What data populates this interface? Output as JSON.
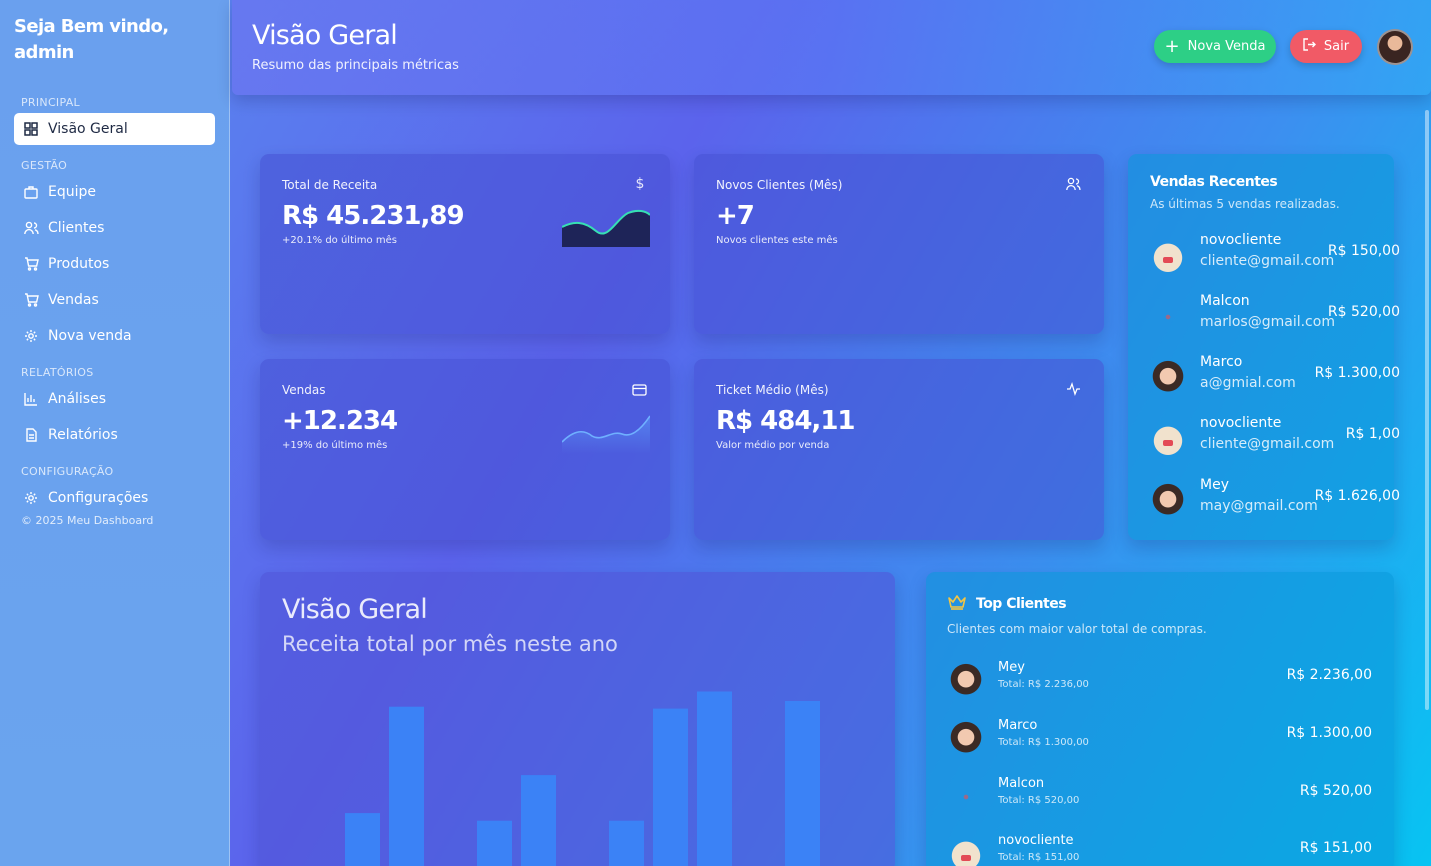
{
  "sidebar": {
    "welcome": "Seja Bem vindo, admin",
    "sections": [
      {
        "label": "PRINCIPAL",
        "items": [
          {
            "label": "Visão Geral",
            "icon": "grid-icon",
            "active": true
          }
        ]
      },
      {
        "label": "GESTÃO",
        "items": [
          {
            "label": "Equipe",
            "icon": "briefcase-icon"
          },
          {
            "label": "Clientes",
            "icon": "users-icon"
          },
          {
            "label": "Produtos",
            "icon": "cart-icon"
          },
          {
            "label": "Vendas",
            "icon": "cart-icon"
          },
          {
            "label": "Nova venda",
            "icon": "gear-icon"
          }
        ]
      },
      {
        "label": "RELATÓRIOS",
        "items": [
          {
            "label": "Análises",
            "icon": "bar-chart-icon"
          },
          {
            "label": "Relatórios",
            "icon": "document-icon"
          }
        ]
      },
      {
        "label": "CONFIGURAÇÃO",
        "items": [
          {
            "label": "Configurações",
            "icon": "gear-icon"
          }
        ]
      }
    ],
    "copyright": "© 2025 Meu Dashboard"
  },
  "header": {
    "title": "Visão Geral",
    "subtitle": "Resumo das principais métricas",
    "new_sale_label": "Nova Venda",
    "logout_label": "Sair"
  },
  "stats": [
    {
      "label": "Total de Receita",
      "value": "R$ 45.231,89",
      "sub": "+20.1% do último mês",
      "icon": "dollar-icon"
    },
    {
      "label": "Novos Clientes (Mês)",
      "value": "+7",
      "sub": "Novos clientes este mês",
      "icon": "users-icon"
    },
    {
      "label": "Vendas",
      "value": "+12.234",
      "sub": "+19% do último mês",
      "icon": "credit-card-icon"
    },
    {
      "label": "Ticket Médio (Mês)",
      "value": "R$ 484,11",
      "sub": "Valor médio por venda",
      "icon": "activity-icon"
    }
  ],
  "recent_sales": {
    "title": "Vendas Recentes",
    "subtitle": "As últimas 5 vendas realizadas.",
    "items": [
      {
        "name": "novocliente",
        "email": "cliente@gmail.com",
        "amount": "R$ 150,00",
        "avatar": "bag"
      },
      {
        "name": "Malcon",
        "email": "marlos@gmail.com",
        "amount": "R$ 520,00",
        "avatar": "dot"
      },
      {
        "name": "Marco",
        "email": "a@gmial.com",
        "amount": "R$ 1.300,00",
        "avatar": "girl"
      },
      {
        "name": "novocliente",
        "email": "cliente@gmail.com",
        "amount": "R$ 1,00",
        "avatar": "bag"
      },
      {
        "name": "Mey",
        "email": "may@gmail.com",
        "amount": "R$ 1.626,00",
        "avatar": "girl"
      }
    ]
  },
  "overview_chart": {
    "title": "Visão Geral",
    "subtitle": "Receita total por mês neste ano",
    "bar_color": "#3b82f6"
  },
  "chart_data": {
    "type": "bar",
    "values": [
      3100,
      8700,
      0,
      2700,
      5100,
      0,
      2700,
      8600,
      9500,
      0,
      9000
    ],
    "ylim": [
      0,
      10000
    ]
  },
  "top_clients": {
    "title": "Top Clientes",
    "subtitle": "Clientes com maior valor total de compras.",
    "items": [
      {
        "name": "Mey",
        "total": "Total: R$ 2.236,00",
        "amount": "R$ 2.236,00",
        "avatar": "girl"
      },
      {
        "name": "Marco",
        "total": "Total: R$ 1.300,00",
        "amount": "R$ 1.300,00",
        "avatar": "girl"
      },
      {
        "name": "Malcon",
        "total": "Total: R$ 520,00",
        "amount": "R$ 520,00",
        "avatar": "dot"
      },
      {
        "name": "novocliente",
        "total": "Total: R$ 151,00",
        "amount": "R$ 151,00",
        "avatar": "bag"
      }
    ]
  },
  "colors": {
    "green": "#2dcf86",
    "red": "#f15a66",
    "crown": "#f5c542"
  }
}
